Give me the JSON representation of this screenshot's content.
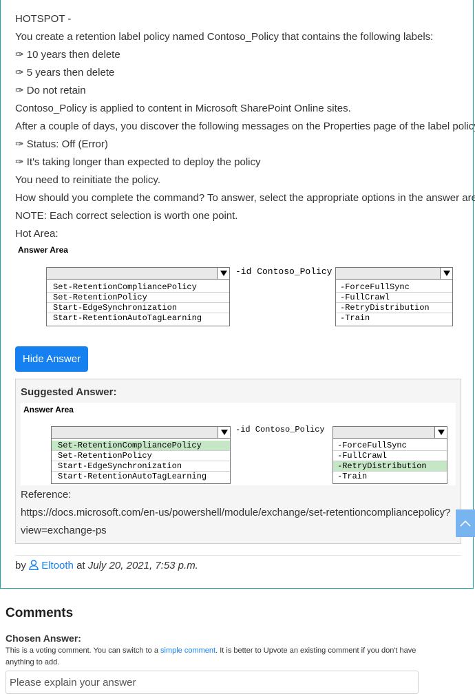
{
  "question": {
    "lines": [
      "HOTSPOT -",
      "You create a retention label policy named Contoso_Policy that contains the following labels:",
      "✑ 10 years then delete",
      "✑ 5 years then delete",
      "✑ Do not retain",
      "Contoso_Policy is applied to content in Microsoft SharePoint Online sites.",
      "After a couple of days, you discover the following messages on the Properties page of the label policy:",
      "✑ Status: Off (Error)",
      "✑ It's taking longer than expected to deploy the policy",
      "You need to reinitiate the policy.",
      "How should you complete the command? To answer, select the appropriate options in the answer area.",
      "NOTE: Each correct selection is worth one point.",
      "Hot Area:"
    ]
  },
  "answer_area": {
    "title": "Answer Area",
    "middle_text": "-id Contoso_Policy",
    "cmdlets": [
      "Set-RetentionCompliancePolicy",
      "Set-RetentionPolicy",
      "Start-EdgeSynchronization",
      "Start-RetentionAutoTagLearning"
    ],
    "switches": [
      "-ForceFullSync",
      "-FullCrawl",
      "-RetryDistribution",
      "-Train"
    ]
  },
  "toggle_button": {
    "label": "Hide Answer"
  },
  "suggested": {
    "title": "Suggested Answer:",
    "answer_title": "Answer Area",
    "middle_text": "-id Contoso_Policy",
    "cmdlets": [
      "Set-RetentionCompliancePolicy",
      "Set-RetentionPolicy",
      "Start-EdgeSynchronization",
      "Start-RetentionAutoTagLearning"
    ],
    "switches": [
      "-ForceFullSync",
      "-FullCrawl",
      "-RetryDistribution",
      "-Train"
    ],
    "selected_cmdlet": "Set-RetentionCompliancePolicy",
    "selected_switch": "-RetryDistribution",
    "highlight_color": "#c6e7c6",
    "reference_label": "Reference:",
    "reference_url_line1": "https://docs.microsoft.com/en-us/powershell/module/exchange/set-retentioncompliancepolicy?",
    "reference_url_line2": "view=exchange-ps"
  },
  "byline": {
    "by": "by",
    "author": "Eltooth",
    "at": "at",
    "date": "July 20, 2021, 7:53 p.m."
  },
  "comments": {
    "heading": "Comments",
    "chosen_label": "Chosen Answer:",
    "voting_text_1": "This is a voting comment. You can switch to a ",
    "voting_link": "simple comment",
    "voting_text_2": ". It is better to Upvote an existing comment if you don't have anything to add.",
    "placeholder": "Please explain your answer"
  },
  "colors": {
    "accent": "#1580f0",
    "card_border": "#1aa3a3"
  }
}
